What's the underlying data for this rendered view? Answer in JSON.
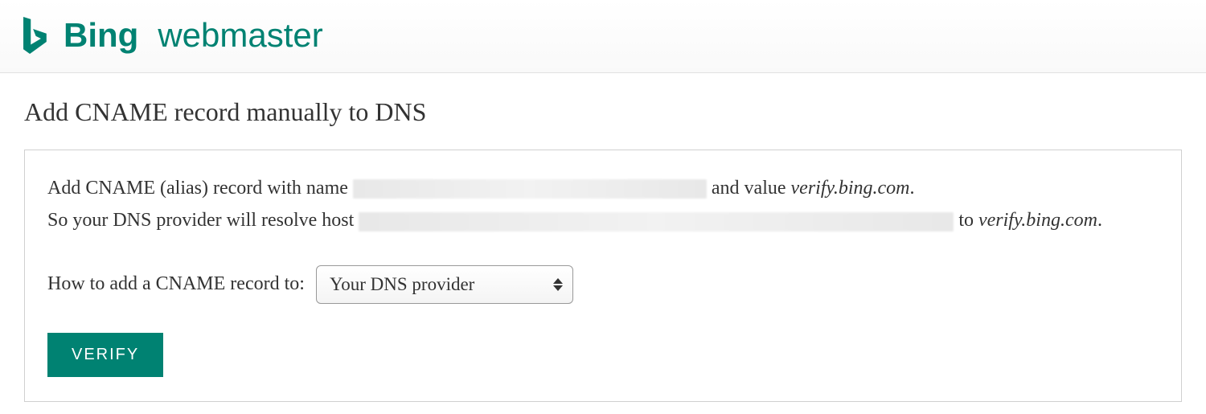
{
  "header": {
    "brand_name": "Bing",
    "product_name": "webmaster"
  },
  "page": {
    "title": "Add CNAME record manually to DNS"
  },
  "instructions": {
    "line1_prefix": "Add CNAME (alias) record with name ",
    "line1_mid": " and value ",
    "line1_value": "verify.bing.com",
    "line1_suffix": ".",
    "line2_prefix": "So your DNS provider will resolve host ",
    "line2_mid": " to ",
    "line2_value": "verify.bing.com",
    "line2_suffix": "."
  },
  "select": {
    "label": "How to add a CNAME record to:",
    "selected": "Your DNS provider"
  },
  "buttons": {
    "verify": "VERIFY"
  }
}
